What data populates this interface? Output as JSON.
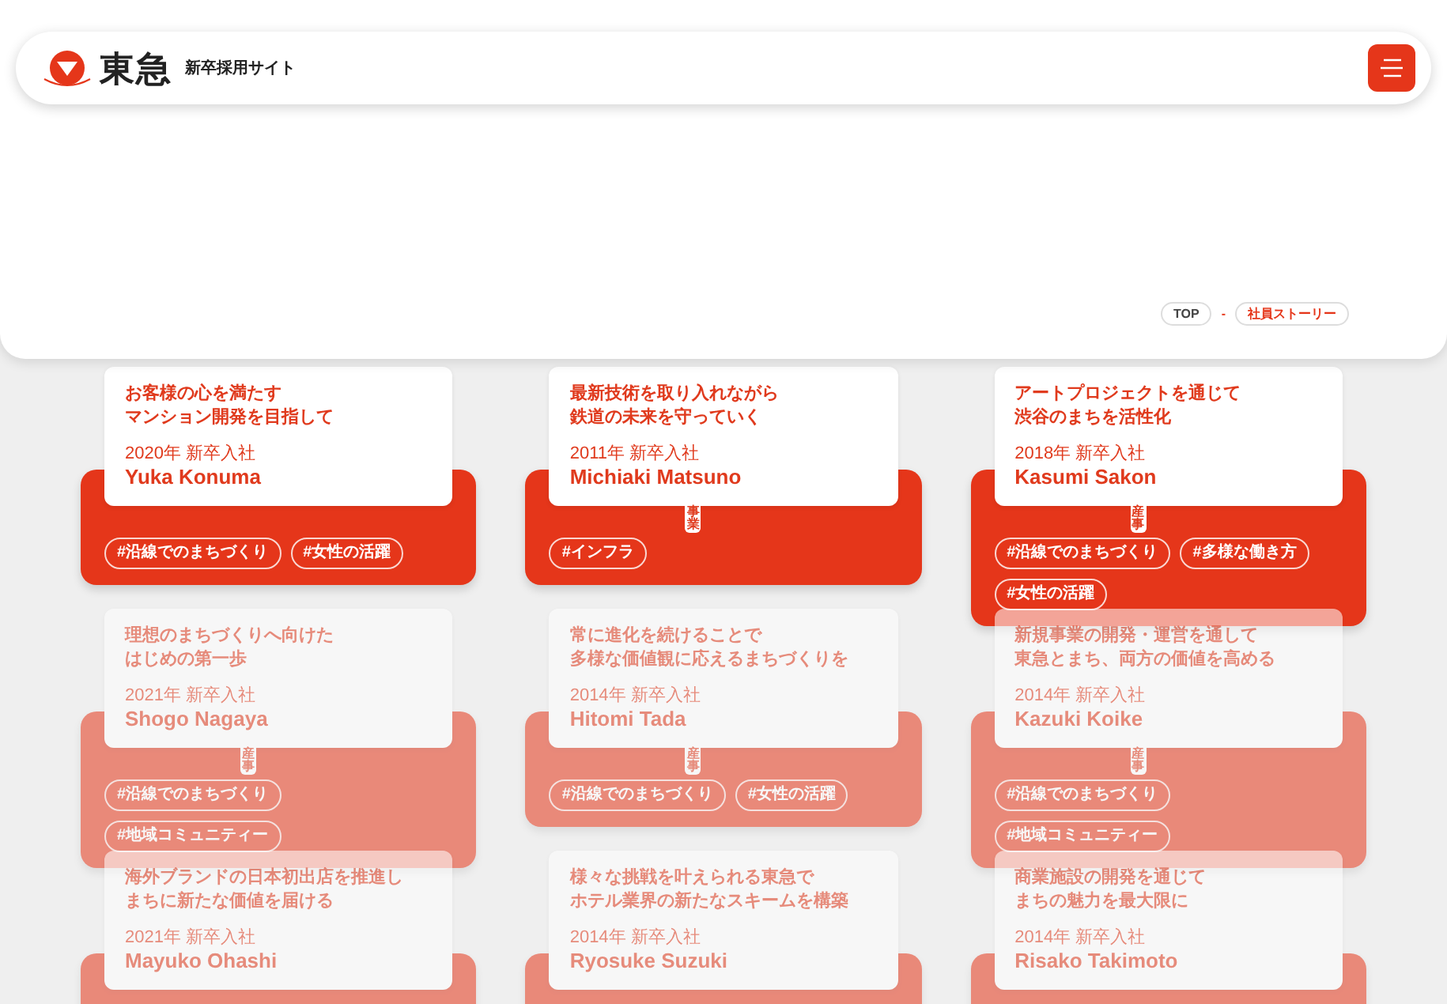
{
  "header": {
    "logo_text": "東急",
    "site_name": "新卒採用サイト"
  },
  "breadcrumb": [
    {
      "label": "TOP",
      "selected": false
    },
    {
      "label": "社員ストーリー",
      "selected": true
    }
  ],
  "breadcrumb_separator": "-",
  "stories": [
    {
      "title_lines": [
        "お客様の心を満たす",
        "マンション開発を目指して"
      ],
      "year": "2020年 新卒入社",
      "name": "Yuka Konuma",
      "tags": [
        "#沿線でのまちづくり",
        "#女性の活躍"
      ],
      "dimmed": false
    },
    {
      "title_lines": [
        "最新技術を取り入れながら",
        "鉄道の未来を守っていく"
      ],
      "year": "2011年 新卒入社",
      "name": "Michiaki Matsuno",
      "tags": [
        "#インフラ"
      ],
      "category": "事業",
      "dimmed": false
    },
    {
      "title_lines": [
        "アートプロジェクトを通じて",
        "渋谷のまちを活性化"
      ],
      "year": "2018年 新卒入社",
      "name": "Kasumi Sakon",
      "tags": [
        "#沿線でのまちづくり",
        "#多様な働き方",
        "#女性の活躍"
      ],
      "category": "産事",
      "dimmed": false
    },
    {
      "title_lines": [
        "理想のまちづくりへ向けた",
        "はじめの第一歩"
      ],
      "year": "2021年 新卒入社",
      "name": "Shogo Nagaya",
      "tags": [
        "#沿線でのまちづくり",
        "#地域コミュニティー"
      ],
      "category": "産事",
      "dimmed": true
    },
    {
      "title_lines": [
        "常に進化を続けることで",
        "多様な価値観に応えるまちづくりを"
      ],
      "year": "2014年 新卒入社",
      "name": "Hitomi Tada",
      "tags": [
        "#沿線でのまちづくり",
        "#女性の活躍"
      ],
      "category": "産事",
      "dimmed": true
    },
    {
      "title_lines": [
        "新規事業の開発・運営を通して",
        "東急とまち、両方の価値を高める"
      ],
      "year": "2014年 新卒入社",
      "name": "Kazuki Koike",
      "tags": [
        "#沿線でのまちづくり",
        "#地域コミュニティー"
      ],
      "category": "産事",
      "dimmed": true
    },
    {
      "title_lines": [
        "海外ブランドの日本初出店を推進し",
        "まちに新たな価値を届ける"
      ],
      "year": "2021年 新卒入社",
      "name": "Mayuko Ohashi",
      "dimmed": true
    },
    {
      "title_lines": [
        "様々な挑戦を叶えられる東急で",
        "ホテル業界の新たなスキームを構築"
      ],
      "year": "2014年 新卒入社",
      "name": "Ryosuke Suzuki",
      "dimmed": true
    },
    {
      "title_lines": [
        "商業施設の開発を通じて",
        "まちの魅力を最大限に"
      ],
      "year": "2014年 新卒入社",
      "name": "Risako Takimoto",
      "dimmed": true
    }
  ]
}
